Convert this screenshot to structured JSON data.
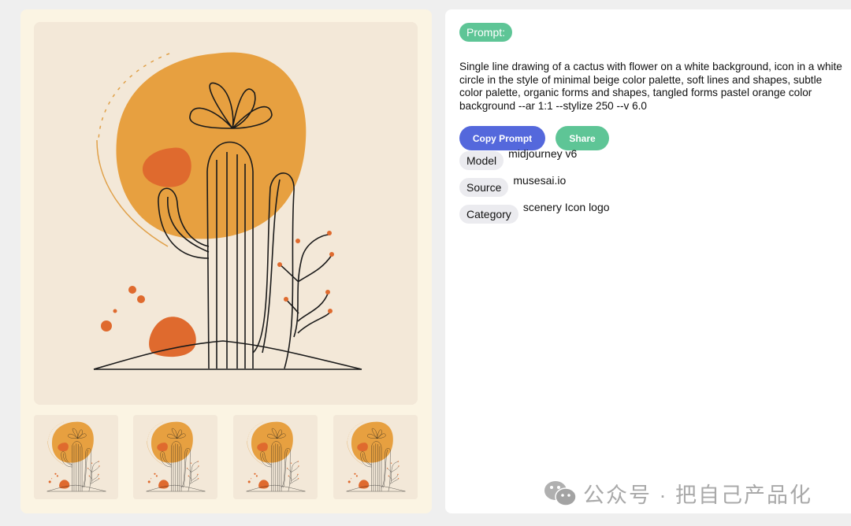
{
  "prompt": {
    "label": "Prompt:",
    "text": "Single line drawing of a cactus with flower on a white background, icon in a white circle in the style of minimal beige color palette, soft lines and shapes, subtle color palette, organic forms and shapes, tangled forms pastel orange color background --ar 1:1 --stylize 250 --v 6.0"
  },
  "actions": {
    "copy_label": "Copy Prompt",
    "share_label": "Share"
  },
  "meta": [
    {
      "key": "Model",
      "value": "midjourney v6"
    },
    {
      "key": "Source",
      "value": "musesai.io"
    },
    {
      "key": "Category",
      "value": "scenery Icon logo"
    }
  ],
  "watermark": {
    "icon": "wechat-icon",
    "text": "公众号 · 把自己产品化"
  },
  "colors": {
    "accent_blue": "#5468dc",
    "accent_green": "#5ec596",
    "image_bg": "#f3e8d8",
    "sun": "#e8a040",
    "blob": "#df6a2e"
  }
}
